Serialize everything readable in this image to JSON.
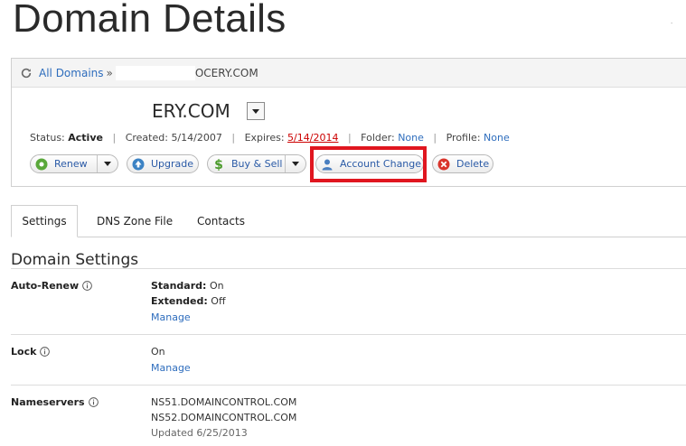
{
  "header": {
    "title": "Domain Details"
  },
  "breadcrumb": {
    "all_domains": "All Domains",
    "separator": "»",
    "domain_visible": "OCERY.COM"
  },
  "domain": {
    "name_visible": "ERY.COM"
  },
  "status": {
    "status_label": "Status:",
    "status_value": "Active",
    "created_label": "Created:",
    "created_value": "5/14/2007",
    "expires_label": "Expires:",
    "expires_value": "5/14/2014",
    "folder_label": "Folder:",
    "folder_value": "None",
    "profile_label": "Profile:",
    "profile_value": "None"
  },
  "actions": {
    "renew": "Renew",
    "upgrade": "Upgrade",
    "buy_sell": "Buy & Sell",
    "account_change": "Account Change",
    "delete": "Delete"
  },
  "tabs": [
    {
      "label": "Settings",
      "active": true
    },
    {
      "label": "DNS Zone File",
      "active": false
    },
    {
      "label": "Contacts",
      "active": false
    }
  ],
  "settings": {
    "section_title": "Domain Settings",
    "auto_renew": {
      "label": "Auto-Renew",
      "standard_label": "Standard:",
      "standard_value": "On",
      "extended_label": "Extended:",
      "extended_value": "Off",
      "manage": "Manage"
    },
    "lock": {
      "label": "Lock",
      "value": "On",
      "manage": "Manage"
    },
    "nameservers": {
      "label": "Nameservers",
      "ns1": "NS51.DOMAINCONTROL.COM",
      "ns2": "NS52.DOMAINCONTROL.COM",
      "updated": "Updated 6/25/2013"
    }
  },
  "colors": {
    "link": "#2e6dbd",
    "highlight": "#e0161f",
    "expired": "#cc0000",
    "renew_icon": "#5aa83a",
    "upgrade_icon": "#3b82c4",
    "delete_icon": "#d9342b"
  }
}
